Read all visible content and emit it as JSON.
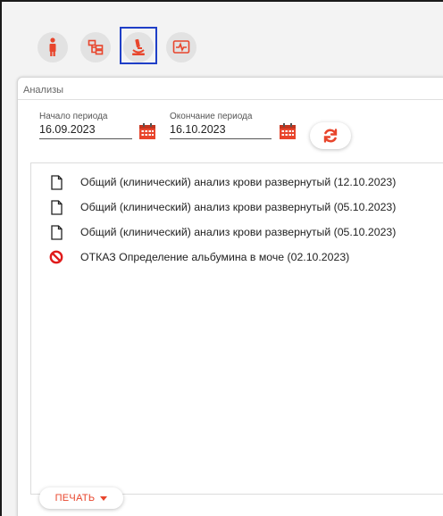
{
  "toolbar": {
    "items": [
      {
        "icon": "person-icon",
        "selected": false
      },
      {
        "icon": "hierarchy-icon",
        "selected": false
      },
      {
        "icon": "microscope-icon",
        "selected": true
      },
      {
        "icon": "ecg-monitor-icon",
        "selected": false
      }
    ]
  },
  "panel": {
    "title": "Анализы",
    "period_start": {
      "label": "Начало периода",
      "value": "16.09.2023"
    },
    "period_end": {
      "label": "Окончание периода",
      "value": "16.10.2023"
    }
  },
  "results": [
    {
      "icon": "document-icon",
      "text": "Общий (клинический) анализ крови развернутый (12.10.2023)"
    },
    {
      "icon": "document-icon",
      "text": "Общий (клинический) анализ крови развернутый (05.10.2023)"
    },
    {
      "icon": "document-icon",
      "text": "Общий (клинический) анализ крови развернутый (05.10.2023)"
    },
    {
      "icon": "refusal-icon",
      "text": "ОТКАЗ Определение альбумина в моче (02.10.2023)"
    }
  ],
  "print_button": {
    "label": "ПЕЧАТЬ"
  },
  "colors": {
    "accent": "#e8452c",
    "selection": "#1f3fc7"
  }
}
